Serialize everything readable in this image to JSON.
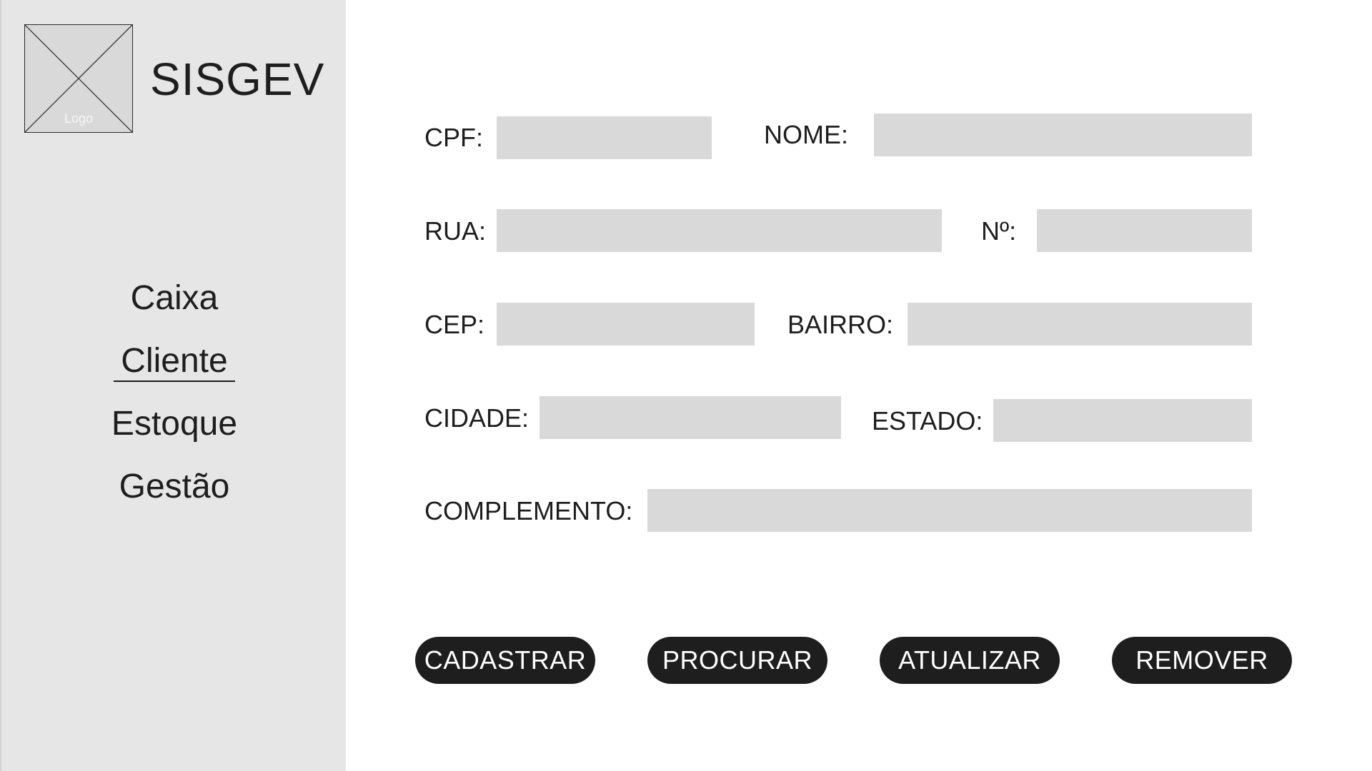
{
  "sidebar": {
    "logo_text": "Logo",
    "app_title": "SISGEV",
    "nav": [
      {
        "label": "Caixa"
      },
      {
        "label": "Cliente"
      },
      {
        "label": "Estoque"
      },
      {
        "label": "Gestão"
      }
    ],
    "active_nav": "Cliente"
  },
  "form": {
    "cpf": {
      "label": "CPF:",
      "value": ""
    },
    "nome": {
      "label": "NOME:",
      "value": ""
    },
    "rua": {
      "label": "RUA:",
      "value": ""
    },
    "numero": {
      "label": "Nº:",
      "value": ""
    },
    "cep": {
      "label": "CEP:",
      "value": ""
    },
    "bairro": {
      "label": "BAIRRO:",
      "value": ""
    },
    "cidade": {
      "label": "CIDADE:",
      "value": ""
    },
    "estado": {
      "label": "ESTADO:",
      "value": ""
    },
    "complemento": {
      "label": "COMPLEMENTO:",
      "value": ""
    }
  },
  "actions": {
    "cadastrar": "CADASTRAR",
    "procurar": "PROCURAR",
    "atualizar": "ATUALIZAR",
    "remover": "REMOVER"
  },
  "colors": {
    "sidebar_bg": "#e6e6e6",
    "field_bg": "#d9d9d9",
    "button_bg": "#1e1e1e",
    "button_text": "#ffffff"
  }
}
